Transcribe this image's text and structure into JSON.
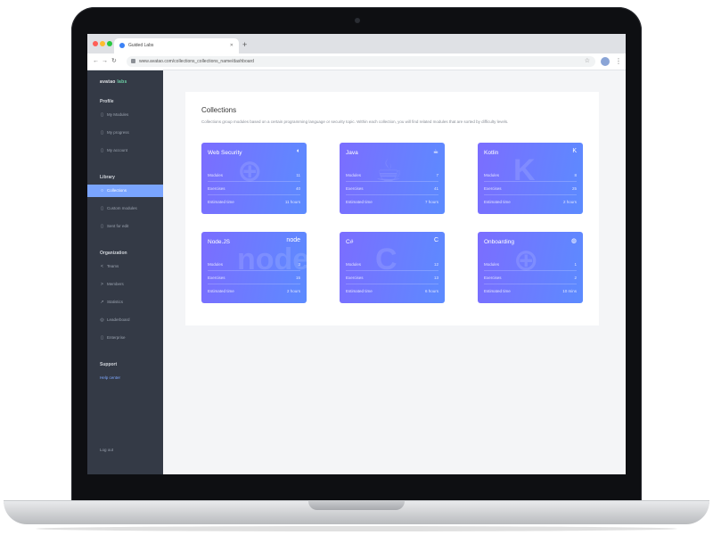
{
  "browser": {
    "tab_title": "Guided Labs",
    "url": "www.avatao.com/collections_collections_name/dashboard",
    "window_dots": [
      "#ff5f57",
      "#febc2e",
      "#28c840"
    ]
  },
  "sidebar": {
    "brand": "avatao",
    "brand_suffix": "labs",
    "sections": [
      {
        "title": "Profile",
        "items": [
          {
            "label": "My Modules",
            "icon": "page-icon"
          },
          {
            "label": "My progress",
            "icon": "page-icon"
          },
          {
            "label": "My account",
            "icon": "page-icon"
          }
        ]
      },
      {
        "title": "Library",
        "items": [
          {
            "label": "Collections",
            "icon": "circle-icon",
            "active": true
          },
          {
            "label": "Custom modules",
            "icon": "page-icon"
          },
          {
            "label": "Sent for edit",
            "icon": "page-icon"
          }
        ]
      },
      {
        "title": "Organization",
        "items": [
          {
            "label": "Teams",
            "icon": "share-icon"
          },
          {
            "label": "Members",
            "icon": "arrow-icon"
          },
          {
            "label": "Statistics",
            "icon": "chart-icon"
          },
          {
            "label": "Leaderboard",
            "icon": "pin-icon"
          },
          {
            "label": "Enterprise",
            "icon": "page-icon"
          }
        ]
      },
      {
        "title": "Support",
        "items": [
          {
            "label": "Help center",
            "link": true
          }
        ]
      }
    ],
    "logout": "Log out"
  },
  "main": {
    "title": "Collections",
    "description": "Collections group modules based on a certain programming language or security topic. Within each collection, you will find related modules that are sorted by difficulty levels.",
    "collections": [
      {
        "name": "Web Security",
        "icon": "shield-icon",
        "badge": "◐",
        "bg": "⊕",
        "rows": [
          {
            "label": "Modules",
            "value": "11"
          },
          {
            "label": "Exercises",
            "value": "40"
          },
          {
            "label": "Estimated time",
            "value": "11 hours"
          }
        ]
      },
      {
        "name": "Java",
        "icon": "java-icon",
        "badge": "☕",
        "bg": "☕",
        "rows": [
          {
            "label": "Modules",
            "value": "7"
          },
          {
            "label": "Exercises",
            "value": "41"
          },
          {
            "label": "Estimated time",
            "value": "7 hours"
          }
        ]
      },
      {
        "name": "Kotlin",
        "icon": "kotlin-icon",
        "badge": "K",
        "bg": "K",
        "rows": [
          {
            "label": "Modules",
            "value": "8"
          },
          {
            "label": "Exercises",
            "value": "25"
          },
          {
            "label": "Estimated time",
            "value": "2 hours"
          }
        ]
      },
      {
        "name": "Node.JS",
        "icon": "node-icon",
        "badge": "node",
        "bg": "node",
        "rows": [
          {
            "label": "Modules",
            "value": "3"
          },
          {
            "label": "Exercises",
            "value": "15"
          },
          {
            "label": "Estimated time",
            "value": "2 hours"
          }
        ]
      },
      {
        "name": "C#",
        "icon": "csharp-icon",
        "badge": "C",
        "bg": "C",
        "rows": [
          {
            "label": "Modules",
            "value": "12"
          },
          {
            "label": "Exercises",
            "value": "13"
          },
          {
            "label": "Estimated time",
            "value": "6 hours"
          }
        ]
      },
      {
        "name": "Onboarding",
        "icon": "globe-icon",
        "badge": "◍",
        "bg": "⊕",
        "rows": [
          {
            "label": "Modules",
            "value": "1"
          },
          {
            "label": "Exercises",
            "value": "2"
          },
          {
            "label": "Estimated time",
            "value": "10 mins"
          }
        ]
      }
    ]
  }
}
